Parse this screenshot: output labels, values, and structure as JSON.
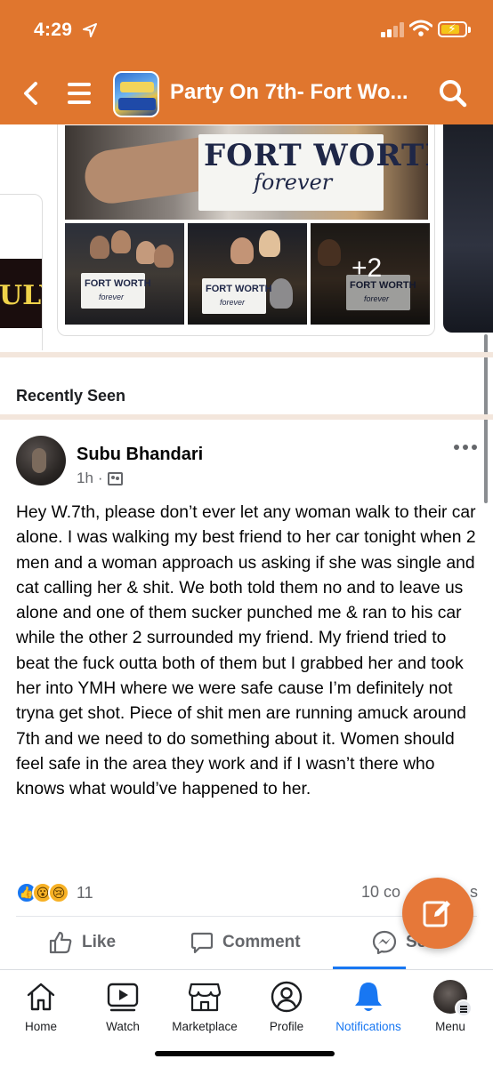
{
  "status_bar": {
    "time": "4:29"
  },
  "header": {
    "title": "Party On 7th- Fort Wo..."
  },
  "photos": {
    "main_sign_line1": "FORT WORTH",
    "main_sign_line2": "forever",
    "thumb_sign_line1": "FORT WORTH",
    "thumb_sign_line2": "forever",
    "more_count": "+2",
    "left_card_text": "ULY"
  },
  "section": {
    "recently_seen": "Recently Seen"
  },
  "post": {
    "author": "Subu Bhandari",
    "time": "1h",
    "separator": "·",
    "text": "Hey W.7th, please don’t ever let any woman walk to their car alone. I was walking my best friend to her car tonight when 2 men and a woman approach us asking if she was single and cat calling her & shit. We both told them no and to leave us alone and one of them sucker punched me & ran to his car while the other 2 surrounded my friend. My friend tried to beat the fuck outta both of them but I grabbed her and took her into YMH where we were safe cause I’m definitely not tryna get shot. Piece of shit men are running amuck around 7th and we need to do something about it. Women should feel safe in the area they work and if I wasn’t there who knows what would’ve happened to her.",
    "reaction_count": "11",
    "comments_label": "10 comments",
    "comments_visible": "10 co",
    "comments_tail": "s",
    "actions": {
      "like": "Like",
      "comment": "Comment",
      "send": "Send"
    }
  },
  "tabs": [
    {
      "label": "Home",
      "icon": "home-icon"
    },
    {
      "label": "Watch",
      "icon": "watch-icon"
    },
    {
      "label": "Marketplace",
      "icon": "marketplace-icon"
    },
    {
      "label": "Profile",
      "icon": "profile-icon"
    },
    {
      "label": "Notifications",
      "icon": "bell-icon",
      "active": true
    },
    {
      "label": "Menu",
      "icon": "menu-avatar"
    }
  ],
  "colors": {
    "header_bg": "#e0762e",
    "fab_bg": "#e67839",
    "active_tab": "#1877f2",
    "secondary_text": "#65676b"
  }
}
